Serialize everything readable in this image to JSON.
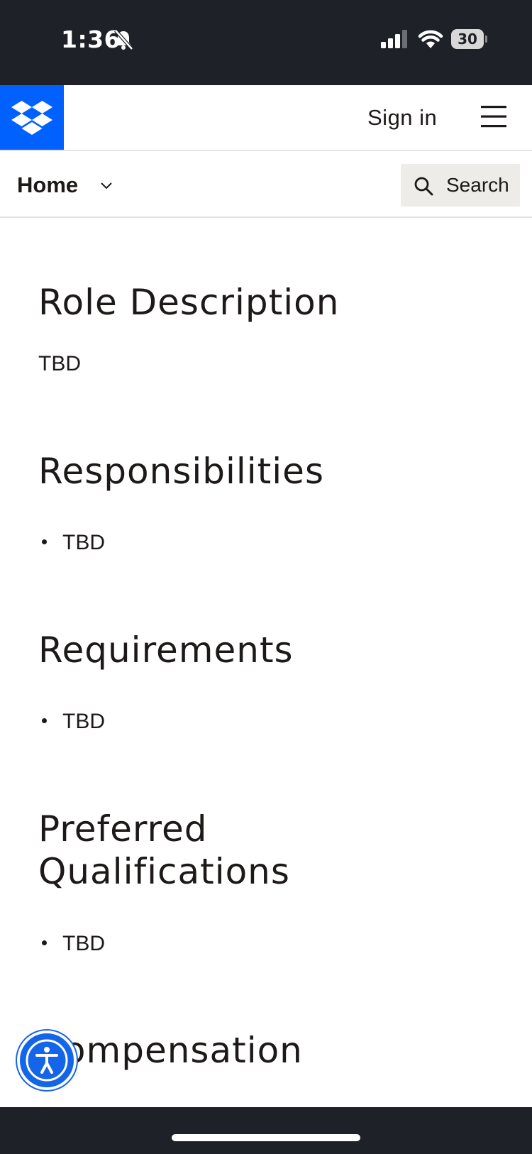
{
  "status_bar": {
    "time": "1:36",
    "battery_level": "30",
    "icons": [
      "bell-slash-icon",
      "cellular-signal-icon",
      "wifi-icon",
      "battery-icon"
    ]
  },
  "header": {
    "logo_icon": "dropbox-logo-icon",
    "brand_color": "#0061fe",
    "sign_in_label": "Sign in",
    "menu_icon": "hamburger-menu-icon"
  },
  "sub_nav": {
    "home_label": "Home",
    "search_label": "Search"
  },
  "sections": [
    {
      "title": "Role Description",
      "text": "TBD"
    },
    {
      "title": "Responsibilities",
      "items": [
        "TBD"
      ]
    },
    {
      "title": "Requirements",
      "items": [
        "TBD"
      ]
    },
    {
      "title_lines": [
        "Preferred",
        "Qualifications"
      ],
      "items": [
        "TBD"
      ]
    },
    {
      "title": "Compensation"
    }
  ],
  "accessibility_button": {
    "icon": "accessibility-icon",
    "color": "#1565e8"
  }
}
